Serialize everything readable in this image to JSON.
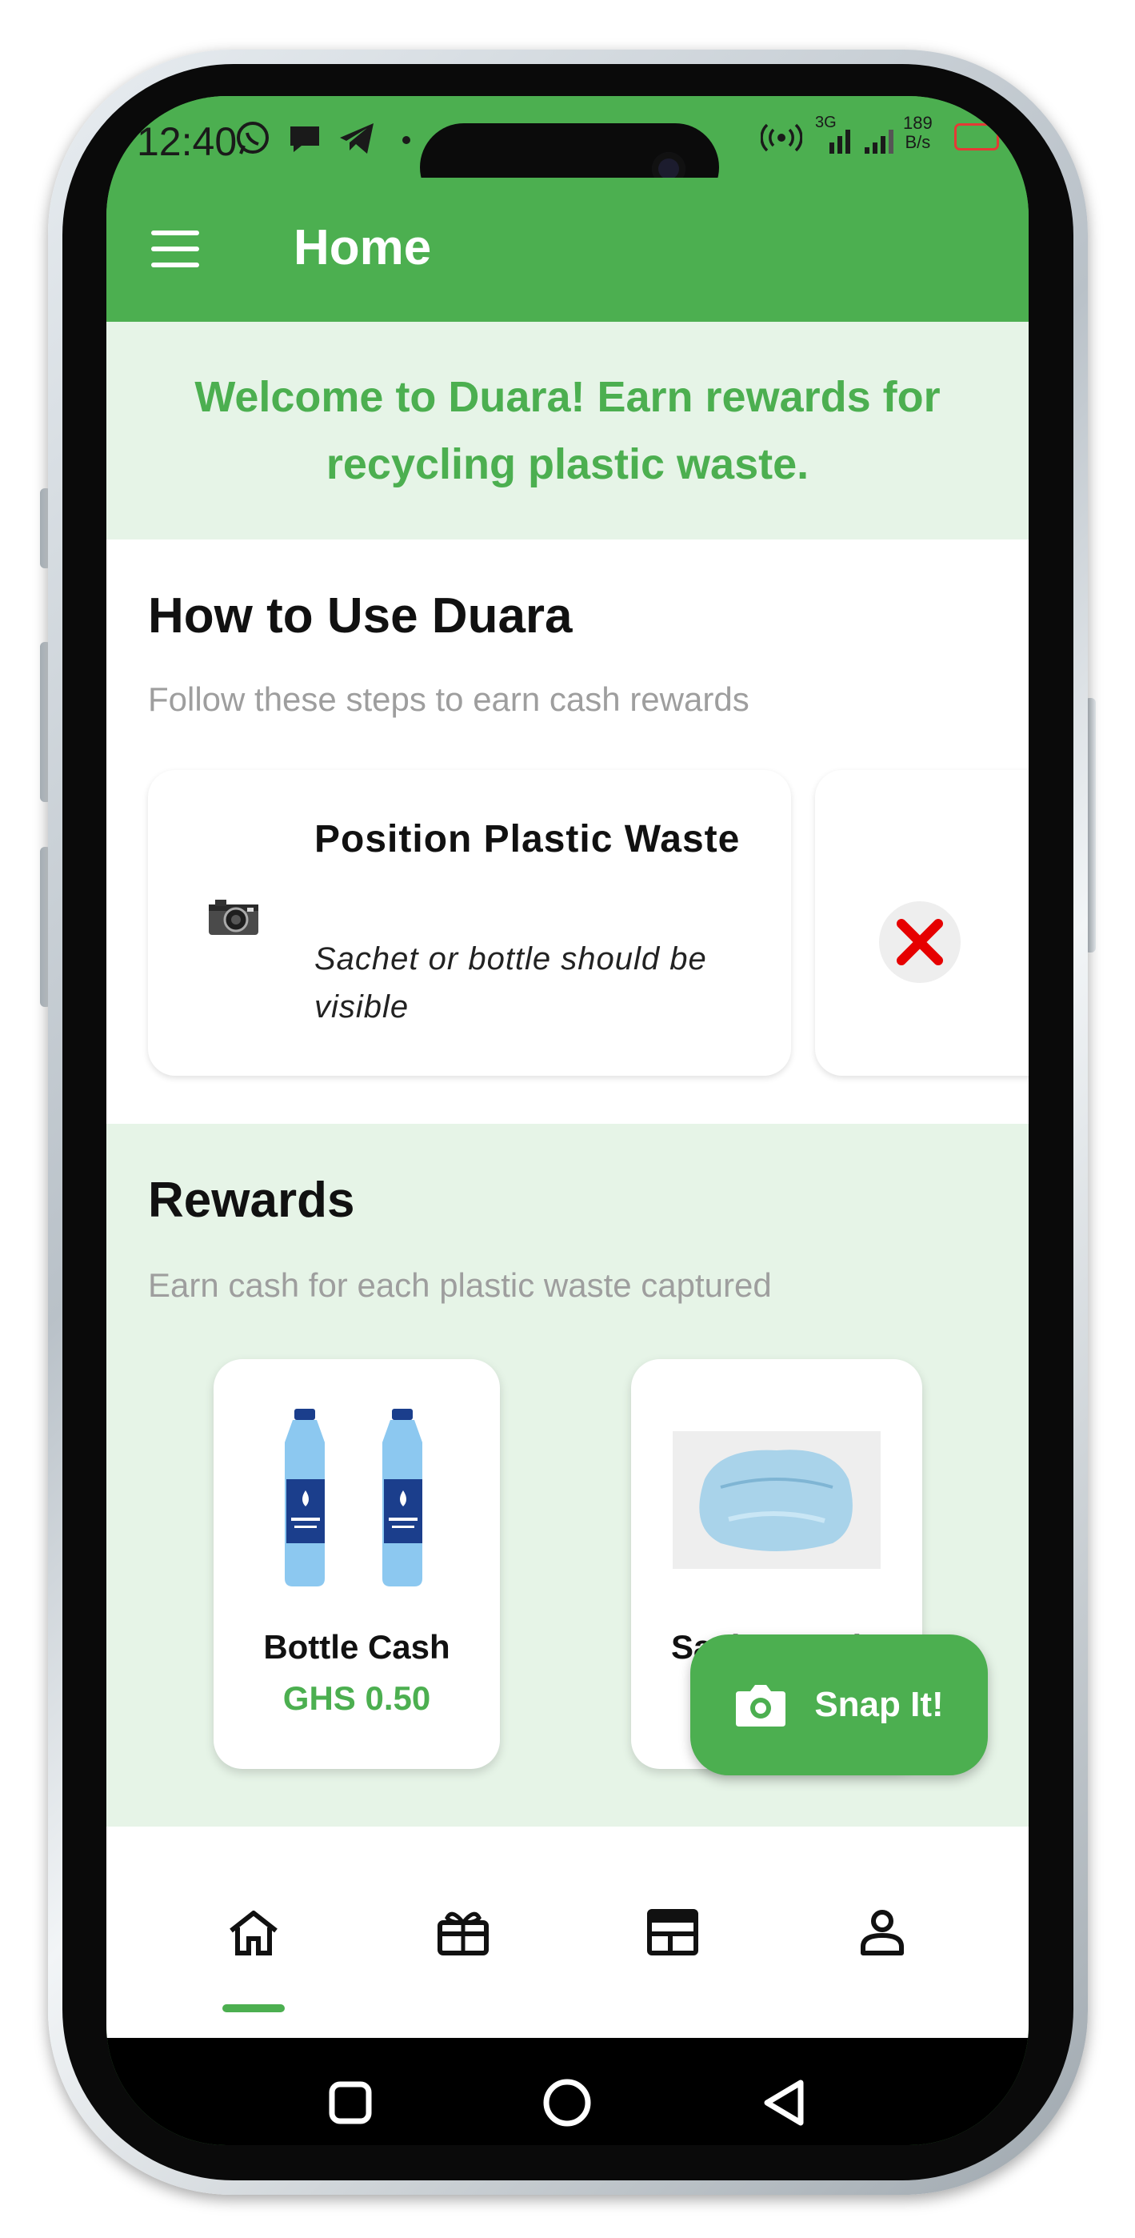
{
  "status_bar": {
    "time": "12:40",
    "icons": [
      "whatsapp-icon",
      "chat-icon",
      "telegram-icon",
      "dot-icon"
    ],
    "network_type": "3G",
    "net_speed_value": "189",
    "net_speed_unit": "B/s"
  },
  "app_bar": {
    "title": "Home",
    "menu_icon": "hamburger-menu-icon"
  },
  "welcome": {
    "text": "Welcome to Duara! Earn rewards for recycling plastic waste."
  },
  "how_to": {
    "title": "How to Use Duara",
    "subtitle": "Follow these steps to earn cash rewards",
    "steps": [
      {
        "icon": "camera-icon",
        "title": "Position Plastic Waste",
        "description": "Sachet or bottle should be visible"
      },
      {
        "icon": "red-x-icon",
        "title": "",
        "description": ""
      }
    ]
  },
  "rewards": {
    "title": "Rewards",
    "subtitle": "Earn cash for each plastic waste captured",
    "items": [
      {
        "name": "Bottle Cash",
        "price": "GHS 0.50",
        "image": "water-bottles-image"
      },
      {
        "name": "Sachet Cash",
        "price": "",
        "image": "sachet-image"
      }
    ]
  },
  "fab": {
    "label": "Snap It!",
    "icon": "camera-icon"
  },
  "bottom_nav": {
    "items": [
      {
        "icon": "home-icon",
        "active": true
      },
      {
        "icon": "gift-card-icon",
        "active": false
      },
      {
        "icon": "newspaper-icon",
        "active": false
      },
      {
        "icon": "profile-icon",
        "active": false
      }
    ]
  },
  "system_nav": [
    "recents-square-icon",
    "home-circle-icon",
    "back-triangle-icon"
  ],
  "colors": {
    "primary_green": "#4caf50",
    "light_green_bg": "#e6f4e7",
    "price_green": "#4caf50",
    "subtitle_gray": "#9e9e9e",
    "error_red": "#e60000"
  }
}
